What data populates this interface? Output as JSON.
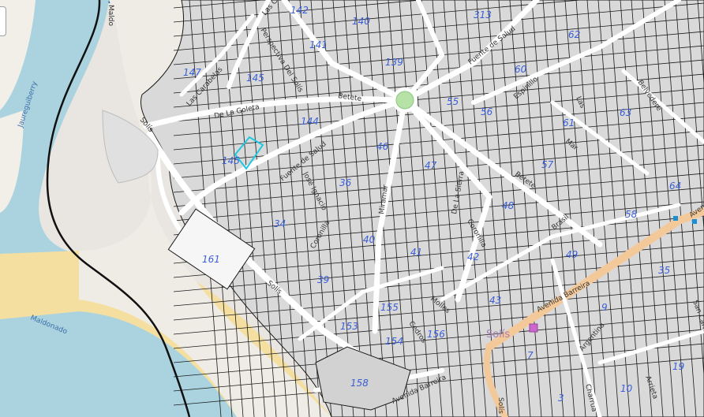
{
  "map": {
    "colors": {
      "water": "#aad3df",
      "sand": "#f5dfa0",
      "land": "#e9e6e2",
      "parcel": "#d9d9d9",
      "parcel_outline": "#1a1a1a",
      "road": "#ffffff",
      "avenue": "#f4c99a",
      "boundary": "#111111",
      "selected_outline": "#1ec8e0",
      "block_number": "#3a5ed6",
      "poi": "#cc66cc",
      "bus_stop": "#1a8fd6"
    },
    "water_labels": {
      "river": "Maldonado",
      "stream": "Jaureguiberry"
    },
    "place_label": "Solís",
    "block_numbers": {
      "b142": "142",
      "b140": "140",
      "b313": "313",
      "b62": "62",
      "b141": "141",
      "b139": "139",
      "b147": "147",
      "b145t": "145",
      "b60": "60",
      "b55": "55",
      "b56": "56",
      "b63": "63",
      "b144": "144",
      "b61": "61",
      "b145": "145",
      "b46": "46",
      "b47": "47",
      "b57": "57",
      "b64": "64",
      "b36": "36",
      "b48": "48",
      "b58": "58",
      "b34": "34",
      "b40": "40",
      "b161": "161",
      "b41": "41",
      "b42": "42",
      "b49": "49",
      "b35": "35",
      "b39": "39",
      "b43": "43",
      "b155": "155",
      "b153": "153",
      "b154": "154",
      "b156": "156",
      "b9": "9",
      "b158": "158",
      "b7": "7",
      "b19": "19",
      "b10": "10",
      "b3": "3"
    },
    "street_names": {
      "las_carabelas": "Las Carabelas",
      "perspectiva": "Perspectiva Del Solís",
      "fuente_salud_top": "Fuente de Salud",
      "belvedere": "Belvedere",
      "de_la_goleta": "De La Goleta",
      "betete_top": "Betete",
      "espinillo": "Espinillo",
      "solis_left": "Solís",
      "fuente_salud_mid": "Fuente de Salud",
      "jose_ignacio": "José Ignacio",
      "miramar": "Miramar",
      "de_la_sierra": "De La Sierra",
      "betete_right": "Betete",
      "mar": "Mar",
      "las_right": "Las",
      "coronilla_left": "Coronilla",
      "coronilla_right": "Coronilla",
      "brasil": "Brasil",
      "avenida_top": "Avenida",
      "avenida_barreira": "Avenida Barreira",
      "solis_lower": "Solís",
      "molles": "Molles",
      "cedros": "Cedros",
      "avenida_barreira_low": "Avenida Barreira",
      "la_cumbre": "Argentina",
      "arrieta": "Arrieta",
      "charrua": "Charrua",
      "san_carlos": "San Carlos",
      "solis_v": "Solís",
      "las_carlos_top": "Las Ca",
      "maldo_top": "Maldo"
    }
  }
}
